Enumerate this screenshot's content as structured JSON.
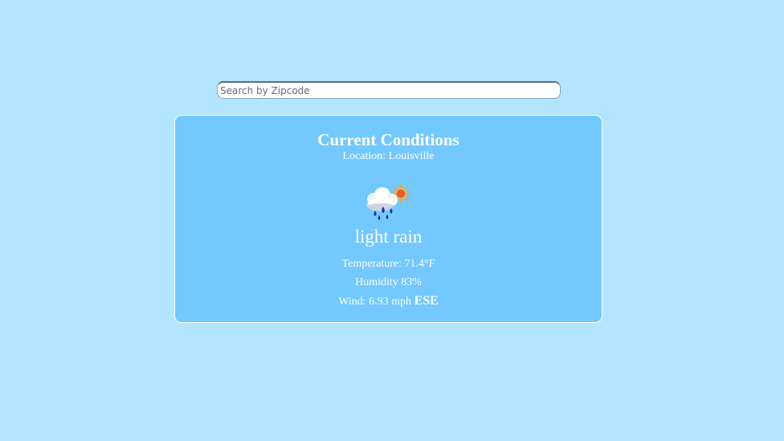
{
  "search": {
    "placeholder": "Search by Zipcode",
    "value": ""
  },
  "card": {
    "title": "Current Conditions",
    "location": "Location: Louisville",
    "icon": "rain-sun-cloud-icon",
    "condition": "light rain",
    "temperature": "Temperature: 71.4°F",
    "humidity": "Humidity 83%",
    "wind_label": "Wind: 6.93 mph",
    "wind_direction": "ESE"
  },
  "colors": {
    "page_background": "#b3e5ff",
    "card_background": "#72c8ff",
    "text": "#ffffff"
  }
}
